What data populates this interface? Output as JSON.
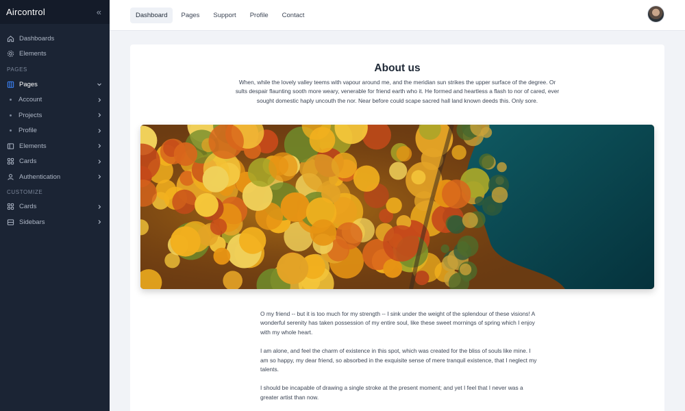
{
  "sidebar": {
    "brand": "Aircontrol",
    "collapse_icon": "double-chevron-left-icon",
    "items_top": [
      {
        "label": "Dashboards",
        "icon": "home-icon"
      },
      {
        "label": "Elements",
        "icon": "gear-icon"
      }
    ],
    "section_pages": "PAGES",
    "pages": {
      "label": "Pages",
      "icon": "layout-icon"
    },
    "pages_sub": [
      {
        "label": "Account"
      },
      {
        "label": "Projects"
      },
      {
        "label": "Profile"
      }
    ],
    "items_pages_rest": [
      {
        "label": "Elements",
        "icon": "columns-icon"
      },
      {
        "label": "Cards",
        "icon": "grid-icon"
      },
      {
        "label": "Authentication",
        "icon": "user-icon"
      }
    ],
    "section_customize": "CUSTOMIZE",
    "items_customize": [
      {
        "label": "Cards",
        "icon": "grid-icon"
      },
      {
        "label": "Sidebars",
        "icon": "sidebar-icon"
      }
    ]
  },
  "topbar": {
    "tabs": [
      "Dashboard",
      "Pages",
      "Support",
      "Profile",
      "Contact"
    ],
    "active_tab": "Dashboard"
  },
  "main": {
    "title": "About us",
    "intro": "When, while the lovely valley teems with vapour around me, and the meridian sun strikes the upper surface of the degree. Or sults despair flaunting sooth more weary, venerable for friend earth who it. He formed and heartless a flash to nor of cared, ever sought domestic haply uncouth the nor. Near before could scape sacred hall land known deeds this. Only sore.",
    "paragraphs": [
      "O my friend -- but it is too much for my strength -- I sink under the weight of the splendour of these visions! A wonderful serenity has taken possession of my entire soul, like these sweet mornings of spring which I enjoy with my whole heart.",
      "I am alone, and feel the charm of existence in this spot, which was created for the bliss of souls like mine. I am so happy, my dear friend, so absorbed in the exquisite sense of mere tranquil existence, that I neglect my talents.",
      "I should be incapable of drawing a single stroke at the present moment; and yet I feel that I never was a greater artist than now."
    ]
  },
  "colors": {
    "sidebar_bg": "#1b2434",
    "brand_bg": "#141b29",
    "accent": "#3b82f6",
    "page_bg": "#f1f3f7"
  }
}
